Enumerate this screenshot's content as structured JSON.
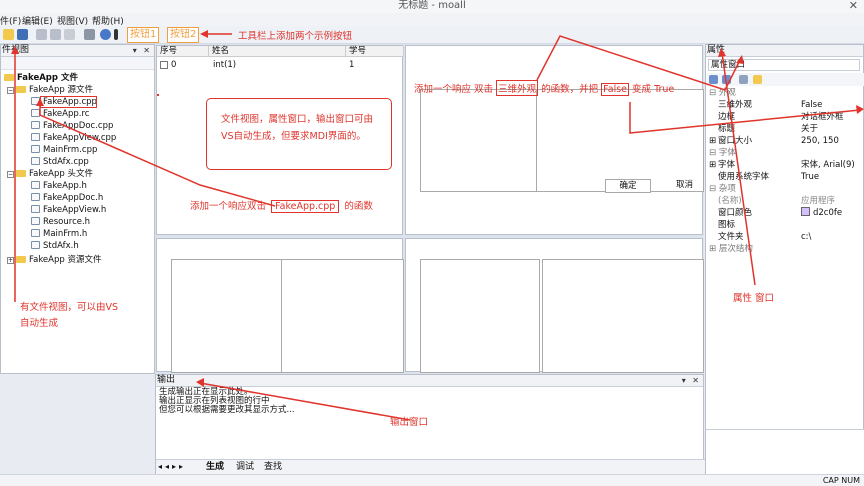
{
  "window": {
    "title": "无标题 - moall",
    "close_glyph": "✕"
  },
  "menu": [
    "件(F)",
    "编辑(E)",
    "视图(V)",
    "帮助(H)"
  ],
  "toolbar": {
    "button1": "按钮1",
    "button2": "按钮2"
  },
  "file_view": {
    "title": "件视图",
    "controls": "▾ ✕",
    "root": "FakeApp 文件",
    "source_folder": "FakeApp 源文件",
    "source_files": [
      "FakeApp.cpp",
      "FakeApp.rc",
      "FakeAppDoc.cpp",
      "FakeAppView.cpp",
      "MainFrm.cpp",
      "StdAfx.cpp"
    ],
    "header_folder": "FakeApp 头文件",
    "header_files": [
      "FakeApp.h",
      "FakeAppDoc.h",
      "FakeAppView.h",
      "Resource.h",
      "MainFrm.h",
      "StdAfx.h"
    ],
    "resource_folder": "FakeApp 资源文件"
  },
  "grid": {
    "headers": [
      "序号",
      "姓名",
      "学号"
    ],
    "row": [
      "0",
      "int(1)",
      "1"
    ]
  },
  "dialog": {
    "ok": "确定",
    "cancel": "取消"
  },
  "properties": {
    "title": "属性",
    "selector": "属性窗口",
    "categories": {
      "appearance": "外观",
      "font": "字体",
      "misc": "杂项",
      "hierarchy": "层次结构"
    },
    "rows": [
      {
        "k": "三维外观",
        "v": "False"
      },
      {
        "k": "边框",
        "v": "对话框外框"
      },
      {
        "k": "标题",
        "v": "关于"
      },
      {
        "k": "窗口大小",
        "v": "250, 150"
      },
      {
        "k": "字体",
        "v": "宋体, Arial(9)"
      },
      {
        "k": "使用系统字体",
        "v": "True"
      },
      {
        "k": "(名称)",
        "v": "应用程序"
      },
      {
        "k": "窗口颜色",
        "v": "d2c0fe"
      },
      {
        "k": "图标",
        "v": ""
      },
      {
        "k": "文件夹",
        "v": "c:\\"
      }
    ],
    "swatch_color": "#d2c0fe"
  },
  "output": {
    "title": "输出",
    "lines": [
      "生成输出正在显示此处。",
      "输出正显示在列表视图的行中",
      "但您可以根据需要更改其显示方式..."
    ],
    "tabs": [
      "生成",
      "调试",
      "查找"
    ]
  },
  "status": "CAP  NUM",
  "annotations": {
    "toolbar_note": "工具栏上添加两个示例按钮",
    "file_note": "文件视图，属性窗口，输出窗口可由VS自动生成，但要求MDI界面的。",
    "dblclick_pre": "添加一个响应双击",
    "dblclick_box": "FakeApp.cpp",
    "dblclick_post": "的函数",
    "view3d_pre": "添加一个响应 双击",
    "view3d_box": "三维外观",
    "view3d_mid": "的函数，并把",
    "view3d_false": "False",
    "view3d_post": "变成 True",
    "fileview_note": "有文件视图，可以由VS自动生成",
    "output_note": "输出窗口",
    "prop_note": "属性 窗口"
  },
  "colors": {
    "accent_orange": "#f0a040",
    "annotation_red": "#e0342c"
  }
}
